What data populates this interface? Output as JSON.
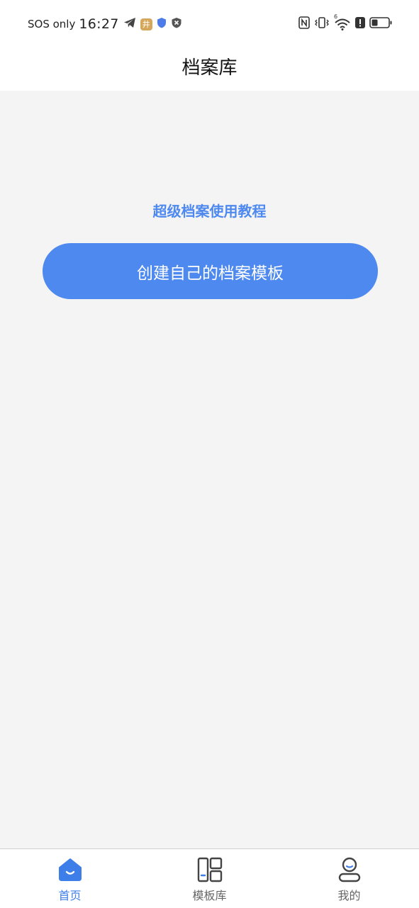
{
  "status_bar": {
    "carrier": "SOS only",
    "time": "16:27",
    "app_badge": "井",
    "wifi_label": "6"
  },
  "header": {
    "title": "档案库"
  },
  "main": {
    "tutorial_link": "超级档案使用教程",
    "create_button": "创建自己的档案模板"
  },
  "tabs": [
    {
      "label": "首页",
      "icon": "home-icon",
      "active": true
    },
    {
      "label": "模板库",
      "icon": "template-library-icon",
      "active": false
    },
    {
      "label": "我的",
      "icon": "profile-icon",
      "active": false
    }
  ],
  "colors": {
    "accent": "#4d89ee",
    "active_tab": "#3e7ee8",
    "background": "#f4f4f4"
  }
}
